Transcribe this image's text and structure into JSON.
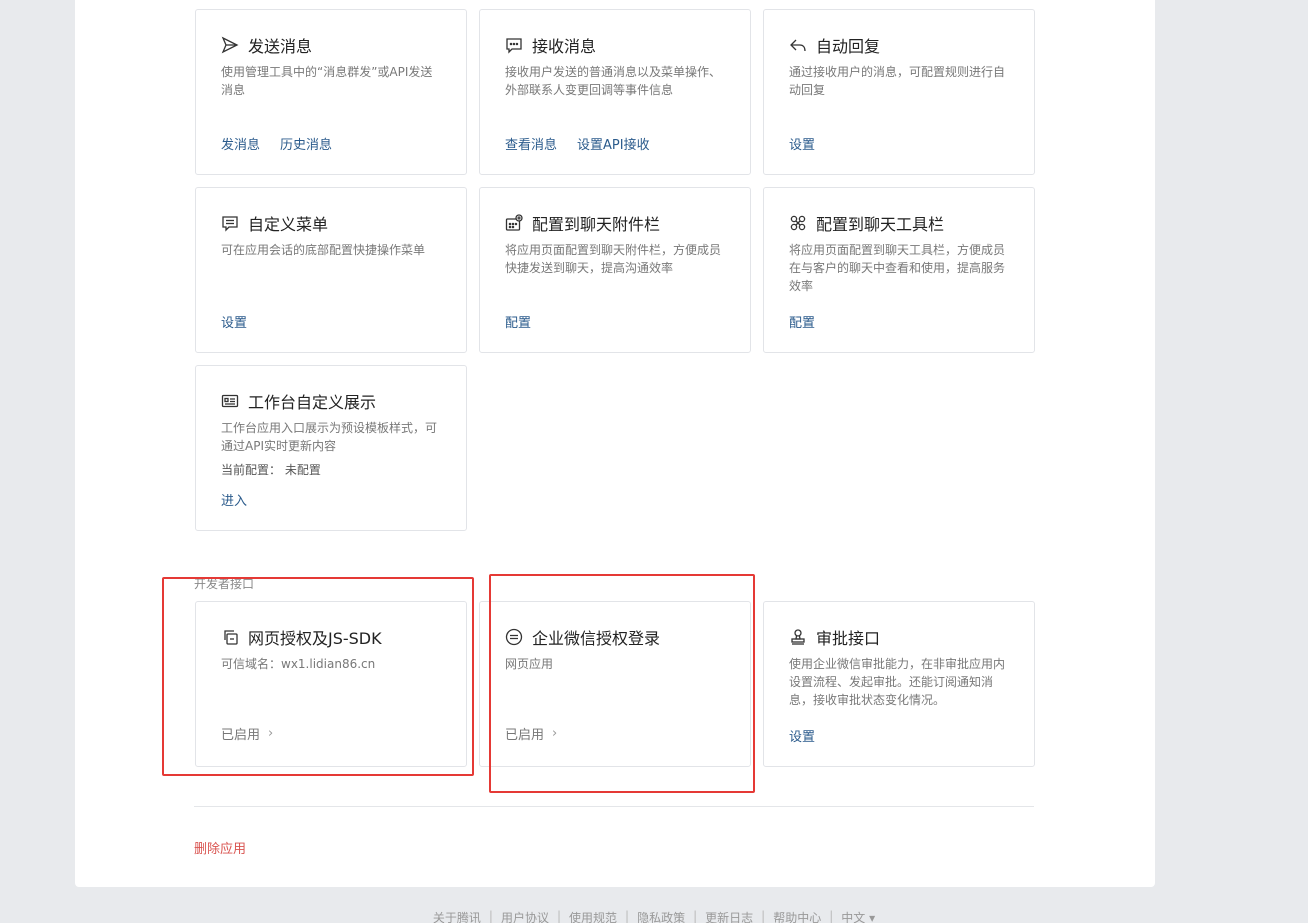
{
  "cards": [
    {
      "icon": "send-icon",
      "title": "发送消息",
      "desc": "使用管理工具中的“消息群发”或API发送消息",
      "links": [
        "发消息",
        "历史消息"
      ]
    },
    {
      "icon": "chat-icon",
      "title": "接收消息",
      "desc": "接收用户发送的普通消息以及菜单操作、外部联系人变更回调等事件信息",
      "links": [
        "查看消息",
        "设置API接收"
      ]
    },
    {
      "icon": "reply-icon",
      "title": "自动回复",
      "desc": "通过接收用户的消息，可配置规则进行自动回复",
      "links": [
        "设置"
      ]
    },
    {
      "icon": "menu-icon",
      "title": "自定义菜单",
      "desc": "可在应用会话的底部配置快捷操作菜单",
      "links": [
        "设置"
      ]
    },
    {
      "icon": "attachment-bar-icon",
      "title": "配置到聊天附件栏",
      "desc": "将应用页面配置到聊天附件栏，方便成员快捷发送到聊天，提高沟通效率",
      "links": [
        "配置"
      ]
    },
    {
      "icon": "toolbar-icon",
      "title": "配置到聊天工具栏",
      "desc": "将应用页面配置到聊天工具栏，方便成员在与客户的聊天中查看和使用，提高服务效率",
      "links": [
        "配置"
      ]
    },
    {
      "icon": "workbench-icon",
      "title": "工作台自定义展示",
      "desc": "工作台应用入口展示为预设模板样式，可通过API实时更新内容",
      "extra": "当前配置： 未配置",
      "links": [
        "进入"
      ]
    }
  ],
  "developer_section": {
    "title": "开发者接口",
    "cards": [
      {
        "icon": "web-auth-icon",
        "title": "网页授权及JS-SDK",
        "desc": "可信域名：wx1.lidian86.cn",
        "status": "已启用"
      },
      {
        "icon": "login-auth-icon",
        "title": "企业微信授权登录",
        "desc": "网页应用",
        "status": "已启用"
      },
      {
        "icon": "approval-icon",
        "title": "审批接口",
        "desc": "使用企业微信审批能力，在非审批应用内设置流程、发起审批。还能订阅通知消息，接收审批状态变化情况。",
        "links": [
          "设置"
        ]
      }
    ]
  },
  "delete_label": "删除应用",
  "footer": [
    "关于腾讯",
    "用户协议",
    "使用规范",
    "隐私政策",
    "更新日志",
    "帮助中心",
    "中文 ▾"
  ],
  "colors": {
    "link": "#2b5b8c",
    "danger": "#d9534f",
    "highlight": "#e53935"
  }
}
